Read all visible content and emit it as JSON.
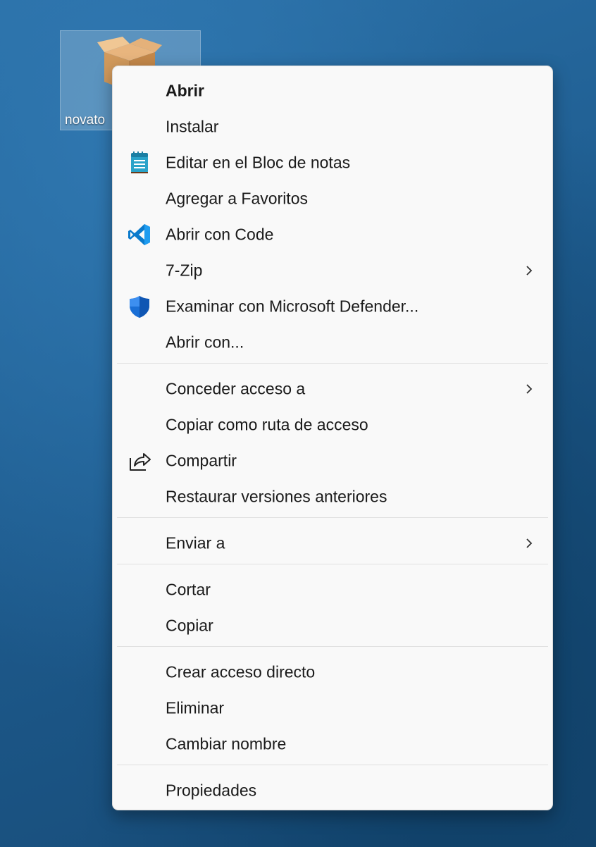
{
  "desktop": {
    "file_icon": {
      "icon": "package-box-icon",
      "label": "novato"
    }
  },
  "menu": {
    "items": [
      {
        "label": "Abrir",
        "bold": true
      },
      {
        "label": "Instalar"
      },
      {
        "label": "Editar en el Bloc de notas",
        "icon": "notepad-icon"
      },
      {
        "label": "Agregar a Favoritos"
      },
      {
        "label": "Abrir con Code",
        "icon": "vscode-icon"
      },
      {
        "label": "7-Zip",
        "submenu": true
      },
      {
        "label": "Examinar con Microsoft Defender...",
        "icon": "defender-shield-icon"
      },
      {
        "label": "Abrir con..."
      },
      {
        "label": "Conceder acceso a",
        "submenu": true
      },
      {
        "label": "Copiar como ruta de acceso"
      },
      {
        "label": "Compartir",
        "icon": "share-icon"
      },
      {
        "label": "Restaurar versiones anteriores"
      },
      {
        "label": "Enviar a",
        "submenu": true
      },
      {
        "label": "Cortar"
      },
      {
        "label": "Copiar"
      },
      {
        "label": "Crear acceso directo"
      },
      {
        "label": "Eliminar"
      },
      {
        "label": "Cambiar nombre"
      },
      {
        "label": "Propiedades"
      }
    ]
  },
  "colors": {
    "menu_background": "#f9f9f9",
    "vscode_blue": "#0a7acc",
    "defender_blue": "#1a6fd6",
    "notepad_teal": "#2aa3c9",
    "box_tan": "#d9a46a"
  }
}
